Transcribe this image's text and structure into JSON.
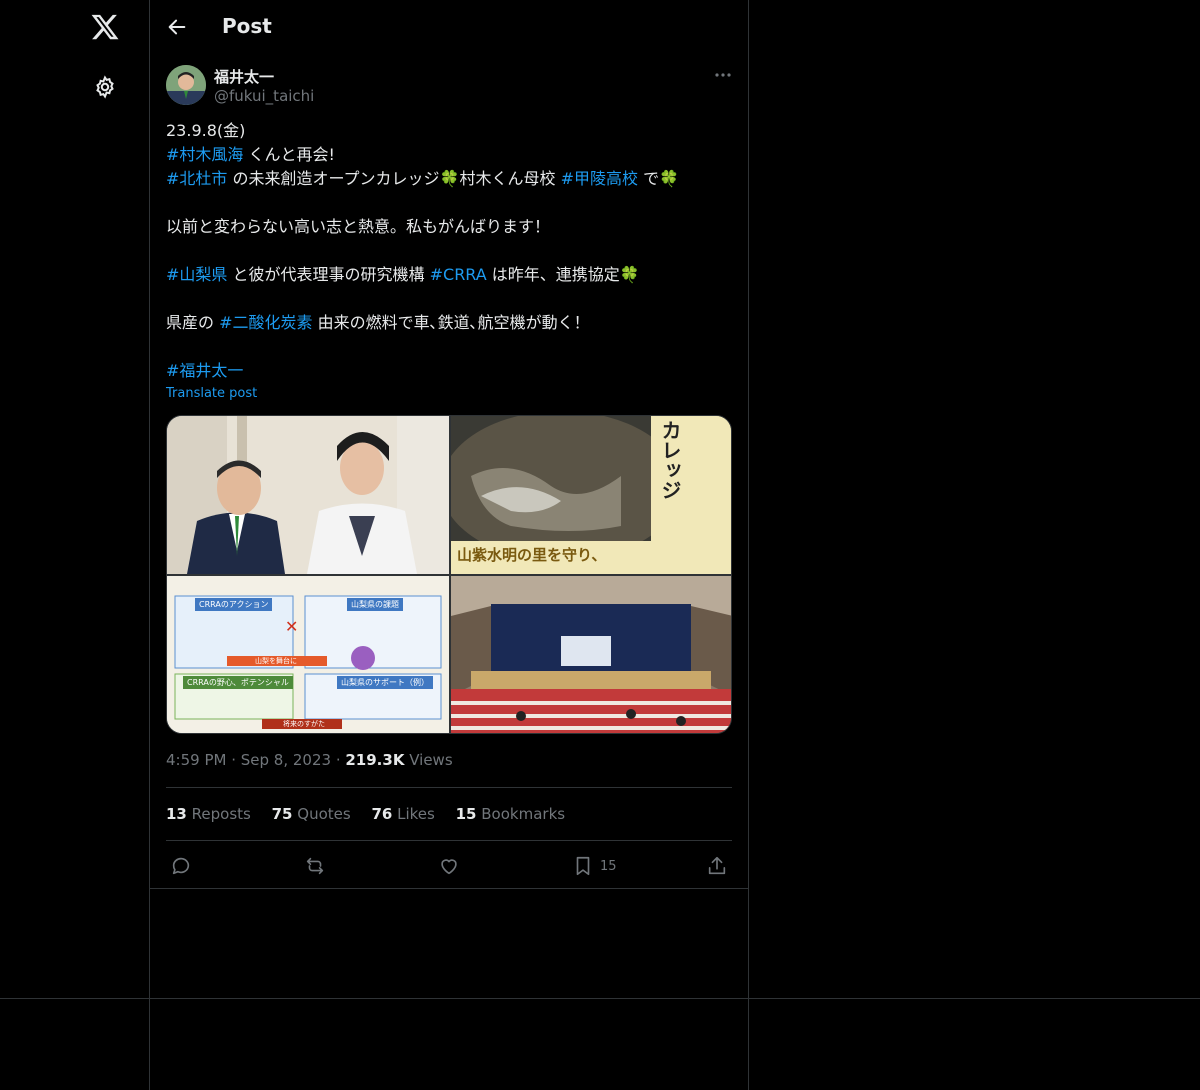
{
  "header": {
    "title": "Post"
  },
  "author": {
    "display_name": "福井太一",
    "handle": "@fukui_taichi"
  },
  "tweet": {
    "line1": "23.9.8(金)",
    "line2_tag": "#村木風海",
    "line2_text": " くんと再会!",
    "line3_tag1": "#北杜市",
    "line3_text1": " の未来創造オープンカレッジ",
    "line3_text2": "村木くん母校 ",
    "line3_tag2": "#甲陵高校",
    "line3_text3": " で",
    "line4": "以前と変わらない高い志と熱意。私もがんばります！",
    "line5_tag1": "#山梨県",
    "line5_text1": " と彼が代表理事の研究機構 ",
    "line5_tag2": "#CRRA",
    "line5_text2": " は昨年、連携協定",
    "line6_text1": "県産の ",
    "line6_tag": "#二酸化炭素",
    "line6_text2": " 由来の燃料で車､鉄道､航空機が動く！",
    "line7_tag": "#福井太一",
    "clover": "🍀",
    "translate": "Translate post"
  },
  "media": {
    "img2_caption": "山紫水明の里を守り、",
    "img2_side": "カレッジ",
    "img3_box1": "CRRAのアクション",
    "img3_box2": "山梨県の課題",
    "img3_box3": "CRRAの野心、ポテンシャル",
    "img3_box4": "山梨県のサポート（例）",
    "img3_mid": "山梨を舞台に",
    "img3_bottom": "将来のすがた"
  },
  "meta": {
    "time": "4:59 PM",
    "sep1": " · ",
    "date": "Sep 8, 2023",
    "sep2": " · ",
    "views_count": "219.3K",
    "views_label": " Views"
  },
  "stats": {
    "reposts_count": "13",
    "reposts_label": " Reposts",
    "quotes_count": "75",
    "quotes_label": " Quotes",
    "likes_count": "76",
    "likes_label": " Likes",
    "bookmarks_count": "15",
    "bookmarks_label": " Bookmarks"
  },
  "actions": {
    "bookmark_count": "15"
  },
  "icons": {
    "logo": "x-logo-icon",
    "settings": "gear-icon",
    "back": "back-arrow-icon",
    "more": "more-icon",
    "reply": "reply-icon",
    "repost": "repost-icon",
    "like": "heart-icon",
    "bookmark": "bookmark-icon",
    "share": "share-icon"
  },
  "colors": {
    "accent": "#1d9bf0",
    "muted": "#71767b",
    "text": "#e7e9ea",
    "border": "#2f3336"
  }
}
